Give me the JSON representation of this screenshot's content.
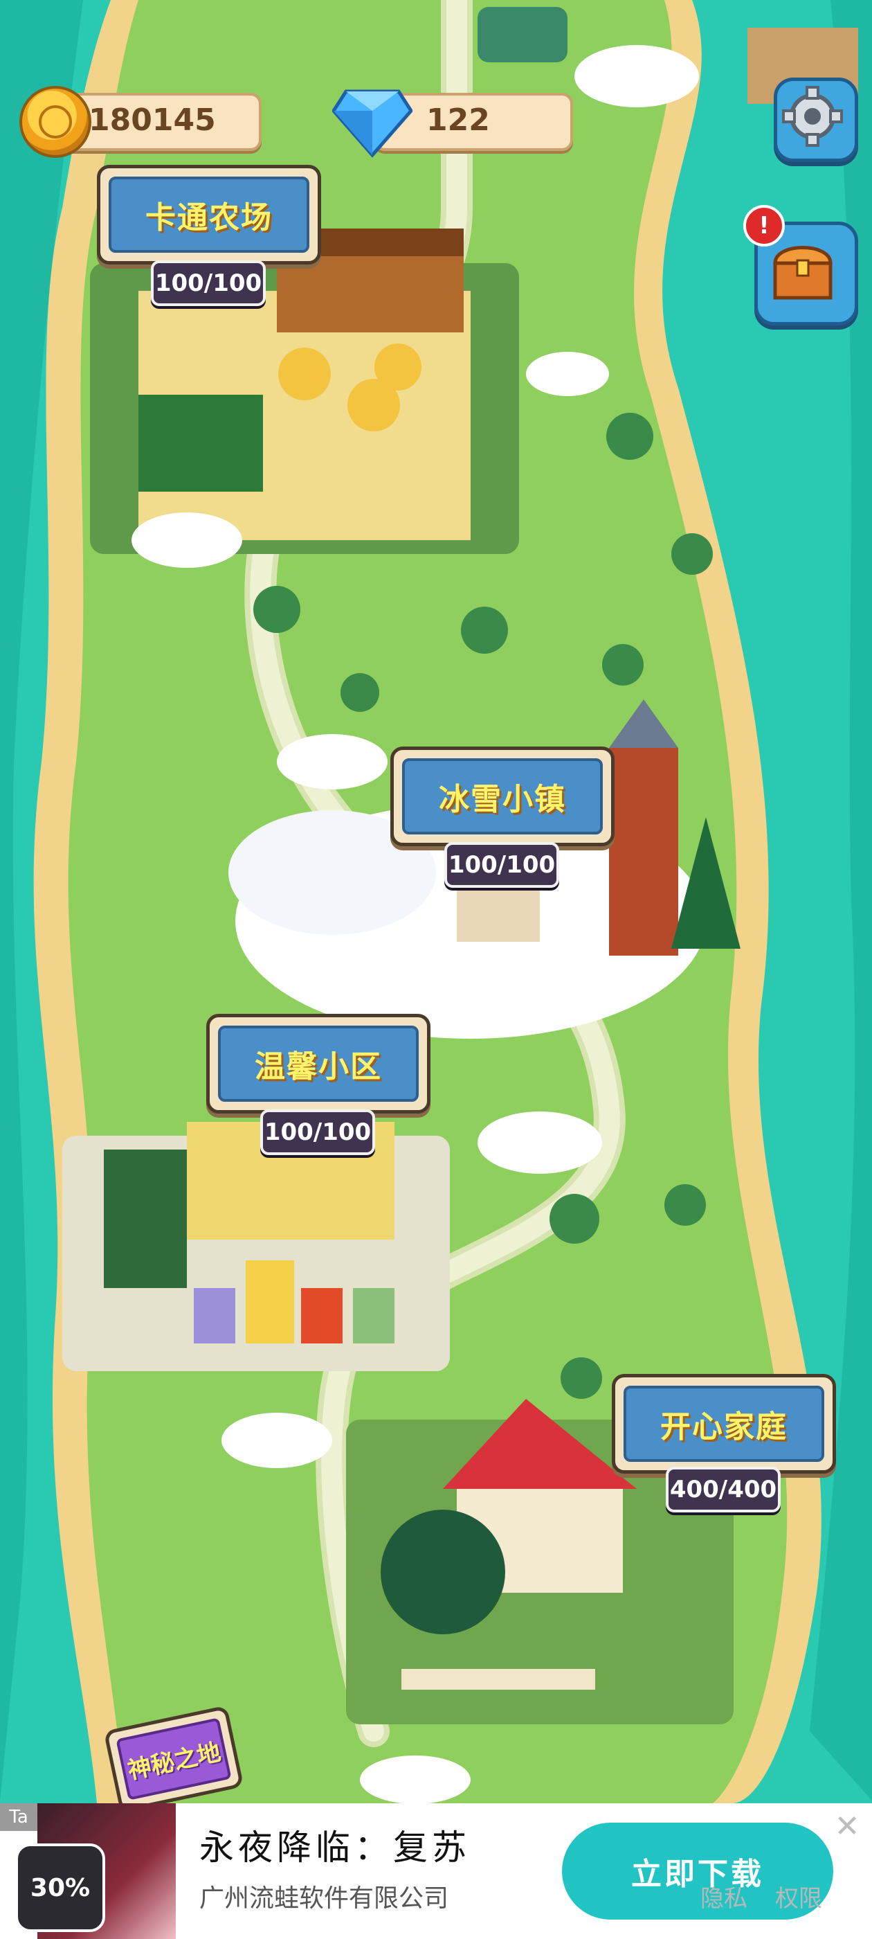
{
  "hud": {
    "coins": "180145",
    "gems": "122"
  },
  "locations": [
    {
      "name": "卡通农场",
      "capacity": "100/100"
    },
    {
      "name": "冰雪小镇",
      "capacity": "100/100"
    },
    {
      "name": "温馨小区",
      "capacity": "100/100"
    },
    {
      "name": "开心家庭",
      "capacity": "400/400"
    },
    {
      "name": "神秘之地",
      "capacity": ""
    }
  ],
  "ad": {
    "title": "永夜降临：复苏",
    "subtitle": "广州流蛙软件有限公司",
    "button": "立即下载",
    "privacy": "隐私",
    "permissions": "权限",
    "badge_percent": "30%",
    "tag": "Ta"
  },
  "colors": {
    "sea": "#2ac9b2",
    "grass": "#8fcf5e",
    "sign_blue": "#4b8fc9",
    "sign_text": "#fff36b",
    "ad_button": "#22c3c3"
  }
}
